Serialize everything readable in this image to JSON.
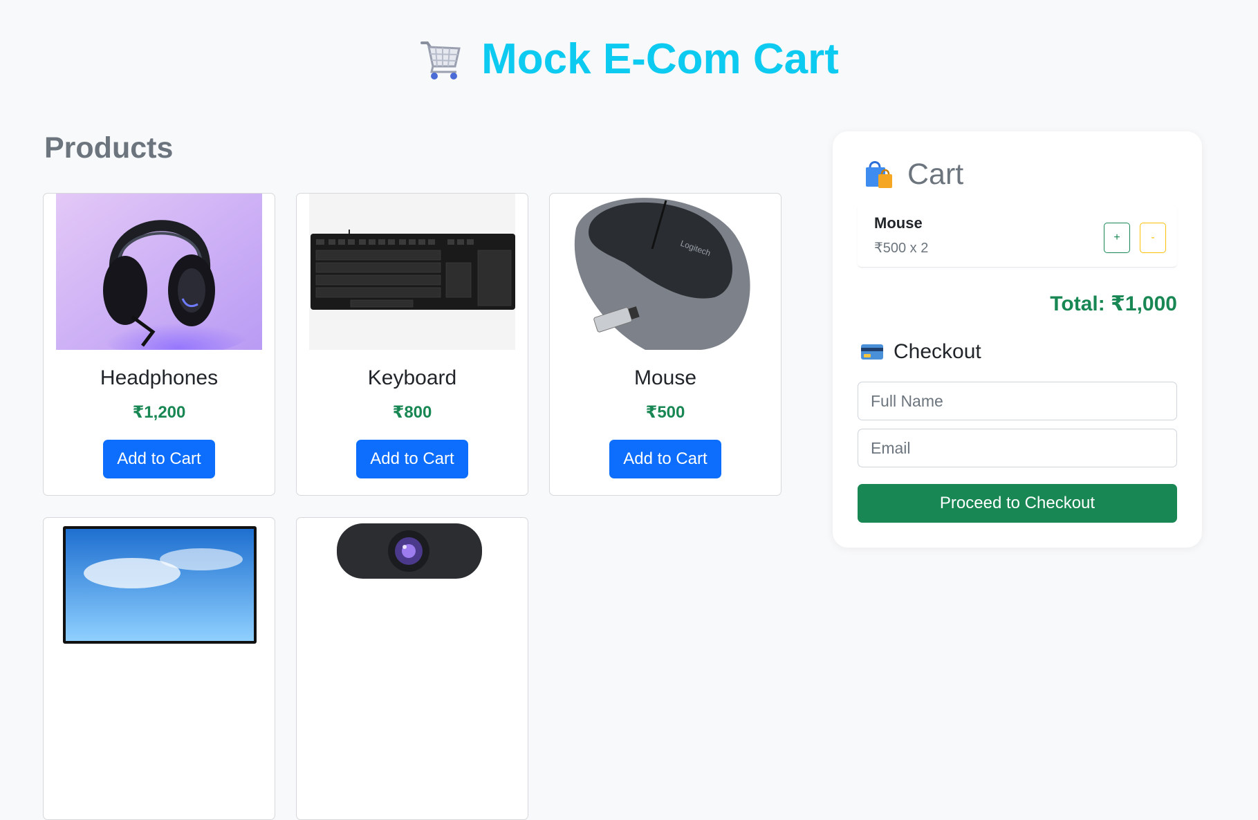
{
  "header": {
    "title": "Mock E-Com Cart",
    "icon": "shopping-cart-icon"
  },
  "products_section": {
    "heading": "Products",
    "items": [
      {
        "name": "Headphones",
        "price": "₹1,200",
        "button_label": "Add to Cart"
      },
      {
        "name": "Keyboard",
        "price": "₹800",
        "button_label": "Add to Cart"
      },
      {
        "name": "Mouse",
        "price": "₹500",
        "button_label": "Add to Cart"
      },
      {
        "name": "",
        "price": "",
        "button_label": ""
      },
      {
        "name": "",
        "price": "",
        "button_label": ""
      }
    ]
  },
  "cart": {
    "heading": "Cart",
    "icon": "shopping-bags-icon",
    "items": [
      {
        "name": "Mouse",
        "qty_text": "₹500 x 2",
        "plus_label": "+",
        "minus_label": "-"
      }
    ],
    "total": "Total: ₹1,000"
  },
  "checkout": {
    "heading": "Checkout",
    "icon": "credit-card-icon",
    "name_placeholder": "Full Name",
    "email_placeholder": "Email",
    "button_label": "Proceed to Checkout"
  },
  "colors": {
    "title": "#0dcaf0",
    "primary": "#0d6efd",
    "success": "#198754",
    "warning": "#ffc107",
    "muted": "#6c757d"
  }
}
